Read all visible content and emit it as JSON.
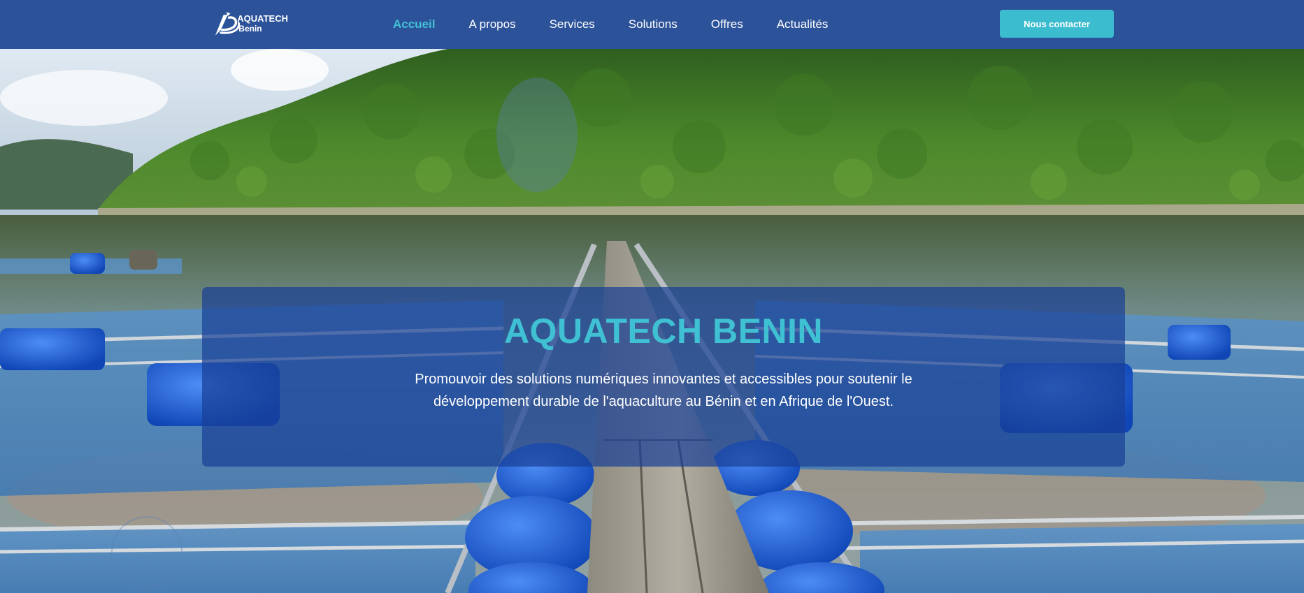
{
  "brand": {
    "name_line1": "AQUATECH",
    "name_line2": "Benin"
  },
  "nav": {
    "items": [
      {
        "label": "Accueil",
        "active": true
      },
      {
        "label": "A propos",
        "active": false
      },
      {
        "label": "Services",
        "active": false
      },
      {
        "label": "Solutions",
        "active": false
      },
      {
        "label": "Offres",
        "active": false
      },
      {
        "label": "Actualités",
        "active": false
      }
    ],
    "cta_label": "Nous contacter"
  },
  "hero": {
    "title": "AQUATECH BENIN",
    "subtitle": "Promouvoir des solutions numériques innovantes et accessibles pour soutenir le développement durable de l'aquaculture au Bénin et en Afrique de l'Ouest."
  },
  "colors": {
    "navbar_bg": "#2c539a",
    "accent": "#3cbccf",
    "overlay": "rgba(24,62,150,0.70)",
    "barrel_blue": "#1f5fd6"
  },
  "icons": {
    "logo": "aquatech-logo-icon"
  }
}
